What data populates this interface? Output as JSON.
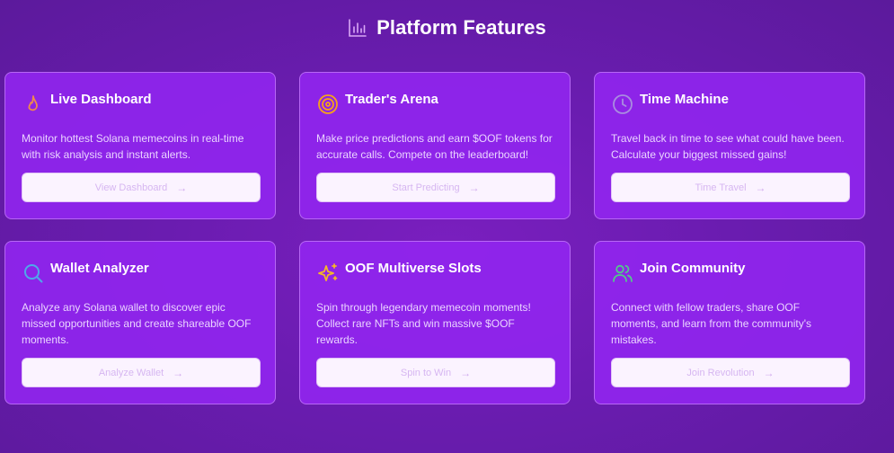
{
  "header": {
    "title": "Platform Features",
    "icon": "bar-chart-icon"
  },
  "colors": {
    "background": "#6a1cb0",
    "card": "#9226f0",
    "button": "#fbf3ff",
    "button_text": "#d6b6f1"
  },
  "cards": [
    {
      "title": "Live Dashboard",
      "icon": "flame-icon",
      "icon_color": "#f08a4c",
      "description_lines": [
        "Monitor hottest Solana memecoins in real-time",
        "with risk analysis and instant alerts."
      ],
      "button": "View Dashboard"
    },
    {
      "title": "Trader's Arena",
      "icon": "target-icon",
      "icon_color": "#f5a21a",
      "description_lines": [
        "Make price predictions and earn $OOF tokens for",
        "accurate calls. Compete on the leaderboard!"
      ],
      "button": "Start Predicting"
    },
    {
      "title": "Time Machine",
      "icon": "clock-icon",
      "icon_color": "#a98ce0",
      "description_lines": [
        "Travel back in time to see what could have been.",
        "Calculate your biggest missed gains!"
      ],
      "button": "Time Travel"
    },
    {
      "title": "Wallet Analyzer",
      "icon": "search-icon",
      "icon_color": "#4fa8ea",
      "description_lines": [
        "Analyze any Solana wallet to discover epic",
        "missed opportunities and create shareable OOF",
        "moments."
      ],
      "button": "Analyze Wallet"
    },
    {
      "title": "OOF Multiverse Slots",
      "icon": "sparkles-icon",
      "icon_color": "#f5b728",
      "description_lines": [
        "Spin through legendary memecoin moments!",
        "Collect rare NFTs and win massive $OOF",
        "rewards."
      ],
      "button": "Spin to Win"
    },
    {
      "title": "Join Community",
      "icon": "users-icon",
      "icon_color": "#52c98b",
      "description_lines": [
        "Connect with fellow traders, share OOF",
        "moments, and learn from the community's",
        "mistakes."
      ],
      "button": "Join Revolution"
    }
  ]
}
